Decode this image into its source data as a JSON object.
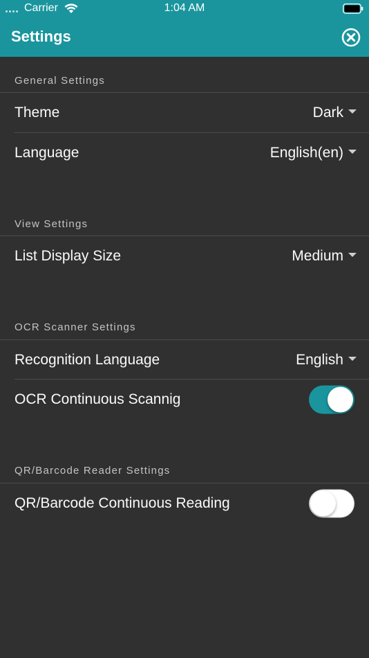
{
  "status_bar": {
    "carrier": "Carrier",
    "time": "1:04 AM",
    "wifi_icon": "wifi-icon",
    "battery_icon": "battery-icon"
  },
  "nav": {
    "title": "Settings",
    "close_icon": "close-circle-icon"
  },
  "colors": {
    "accent": "#1a959d",
    "background": "#303030",
    "divider": "#4c4c4c",
    "section_text": "#c4c4c4"
  },
  "sections": {
    "general": {
      "header": "General Settings",
      "theme": {
        "label": "Theme",
        "value": "Dark"
      },
      "language": {
        "label": "Language",
        "value": "English(en)"
      }
    },
    "view": {
      "header": "View Settings",
      "list_display_size": {
        "label": "List Display Size",
        "value": "Medium"
      }
    },
    "ocr": {
      "header": "OCR Scanner Settings",
      "recognition_language": {
        "label": "Recognition Language",
        "value": "English"
      },
      "continuous_scanning": {
        "label": "OCR Continuous Scannig",
        "enabled": true
      }
    },
    "qr": {
      "header": "QR/Barcode Reader Settings",
      "continuous_reading": {
        "label": "QR/Barcode Continuous Reading",
        "enabled": false
      }
    }
  }
}
